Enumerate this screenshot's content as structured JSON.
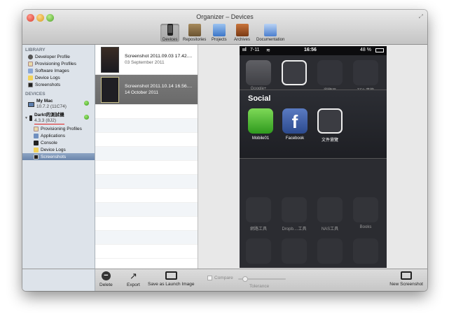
{
  "window": {
    "title": "Organizer – Devices"
  },
  "toolbar": {
    "items": [
      {
        "label": "Devices"
      },
      {
        "label": "Repositories"
      },
      {
        "label": "Projects"
      },
      {
        "label": "Archives"
      },
      {
        "label": "Documentation"
      }
    ]
  },
  "sidebar": {
    "library_header": "LIBRARY",
    "library_items": [
      {
        "label": "Developer Profile",
        "icon": "user-icon"
      },
      {
        "label": "Provisioning Profiles",
        "icon": "profile-icon"
      },
      {
        "label": "Software Images",
        "icon": "software-icon"
      },
      {
        "label": "Device Logs",
        "icon": "log-icon"
      },
      {
        "label": "Screenshots",
        "icon": "screenshot-icon"
      }
    ],
    "devices_header": "DEVICES",
    "devices": [
      {
        "name": "My Mac",
        "sub": "10.7.2 (11C74)"
      },
      {
        "name": "Darkt的測試機",
        "sub": "4.3.3 (8J2)"
      }
    ],
    "device_items": [
      {
        "label": "Provisioning Profiles"
      },
      {
        "label": "Applications"
      },
      {
        "label": "Console"
      },
      {
        "label": "Device Logs"
      },
      {
        "label": "Screenshots"
      }
    ]
  },
  "screenshots": [
    {
      "title": "Screenshot 2011.09.03 17.42....",
      "date": "03 September 2011"
    },
    {
      "title": "Screenshot 2011.10.14 16.56....",
      "date": "14 October 2011"
    }
  ],
  "phone": {
    "carrier": "7-11",
    "time": "16:56",
    "battery": "48 %",
    "folder_title": "Social",
    "top_apps": [
      "Google+",
      "",
      "瀏覽器",
      "TF2 書籤"
    ],
    "social_apps": [
      "Mobile01",
      "Facebook",
      "文件瀏覽"
    ],
    "bottom_apps": [
      "網路工具",
      "Dropb....工具",
      "NAS工具",
      "Books"
    ]
  },
  "bottom": {
    "delete": "Delete",
    "export": "Export",
    "save_launch": "Save as Launch Image",
    "compare": "Compare",
    "tolerance": "Tolerance",
    "new_screenshot": "New Screenshot"
  }
}
